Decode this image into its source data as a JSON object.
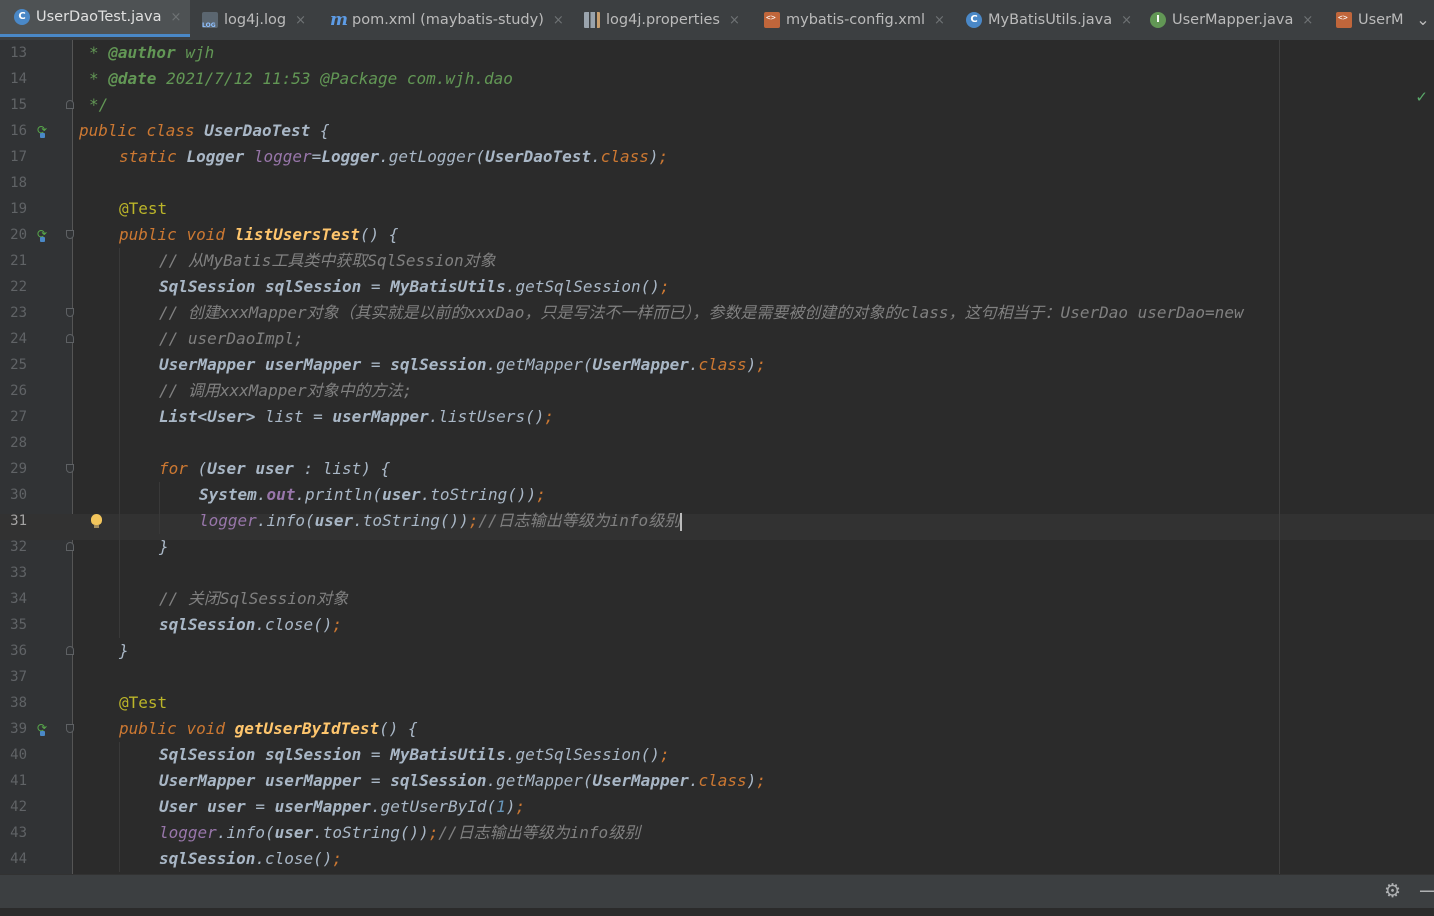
{
  "tabs": [
    {
      "label": "UserDaoTest.java",
      "icon": "java-class-icon",
      "active": true
    },
    {
      "label": "log4j.log",
      "icon": "log-file-icon"
    },
    {
      "label": "pom.xml (maybatis-study)",
      "icon": "maven-icon"
    },
    {
      "label": "log4j.properties",
      "icon": "properties-file-icon"
    },
    {
      "label": "mybatis-config.xml",
      "icon": "xml-file-icon"
    },
    {
      "label": "MyBatisUtils.java",
      "icon": "java-class-icon"
    },
    {
      "label": "UserMapper.java",
      "icon": "java-interface-icon"
    },
    {
      "label": "UserM",
      "icon": "xml-file-icon"
    }
  ],
  "tab_close_glyph": "×",
  "editor": {
    "current_line": "31",
    "line_numbers": [
      "13",
      "14",
      "15",
      "16",
      "17",
      "18",
      "19",
      "20",
      "21",
      "22",
      "23",
      "24",
      "25",
      "26",
      "27",
      "28",
      "29",
      "30",
      "31",
      "32",
      "33",
      "34",
      "35",
      "36",
      "37",
      "38",
      "39",
      "40",
      "41",
      "42",
      "43",
      "44"
    ],
    "code": {
      "l13_tag": "@author",
      "l13_text": " wjh",
      "l14_tag": "@date",
      "l14_text": " 2021/7/12 11:53 @Package com.wjh.dao",
      "l15_text": "*/",
      "l16_kw1": "public",
      "l16_kw2": "class",
      "l16_name": "UserDaoTest",
      "l16_brace": " {",
      "l17_kw": "static",
      "l17_type": "Logger",
      "l17_field": "logger",
      "l17_eq": "=",
      "l17_cls": "Logger",
      "l17_m": "getLogger",
      "l17_arg": "UserDaoTest",
      "l17_class": "class",
      "l19_ann": "@Test",
      "l20_kw1": "public",
      "l20_kw2": "void",
      "l20_name": "listUsersTest",
      "l21_cm": "// 从MyBatis工具类中获取SqlSession对象",
      "l22_type": "SqlSession",
      "l22_var": "sqlSession",
      "l22_cls": "MyBatisUtils",
      "l22_m": "getSqlSession",
      "l23_cm": "// 创建xxxMapper对象（其实就是以前的xxxDao，只是写法不一样而已），参数是需要被创建的对象的class，这句相当于：UserDao userDao=new",
      "l24_cm": "// userDaoImpl;",
      "l25_type": "UserMapper",
      "l25_var": "userMapper",
      "l25_obj": "sqlSession",
      "l25_m": "getMapper",
      "l25_arg": "UserMapper",
      "l25_class": "class",
      "l26_cm": "// 调用xxxMapper对象中的方法;",
      "l27_type": "List<User>",
      "l27_var": "list",
      "l27_obj": "userMapper",
      "l27_m": "listUsers",
      "l29_kw": "for",
      "l29_type": "User",
      "l29_var": "user",
      "l29_list": "list",
      "l30_cls": "System",
      "l30_field": "out",
      "l30_m": "println",
      "l30_obj": "user",
      "l30_m2": "toString",
      "l31_field": "logger",
      "l31_m": "info",
      "l31_obj": "user",
      "l31_m2": "toString",
      "l31_cm": "//日志输出等级为info级别",
      "l34_cm": "// 关闭SqlSession对象",
      "l35_obj": "sqlSession",
      "l35_m": "close",
      "l38_ann": "@Test",
      "l39_kw1": "public",
      "l39_kw2": "void",
      "l39_name": "getUserByIdTest",
      "l40_type": "SqlSession",
      "l40_var": "sqlSession",
      "l40_cls": "MyBatisUtils",
      "l40_m": "getSqlSession",
      "l41_type": "UserMapper",
      "l41_var": "userMapper",
      "l41_obj": "sqlSession",
      "l41_m": "getMapper",
      "l41_arg": "UserMapper",
      "l41_class": "class",
      "l42_type": "User",
      "l42_var": "user",
      "l42_obj": "userMapper",
      "l42_m": "getUserById",
      "l42_num": "1",
      "l43_field": "logger",
      "l43_m": "info",
      "l43_obj": "user",
      "l43_m2": "toString",
      "l43_cm": "//日志输出等级为info级别",
      "l44_obj": "sqlSession",
      "l44_m": "close"
    }
  },
  "colors": {
    "background": "#2b2b2b",
    "gutter": "#313335",
    "keyword": "#cc7832",
    "comment": "#808080",
    "doc_comment": "#629755",
    "annotation": "#bbb529",
    "field": "#9876aa",
    "method": "#ffc66d",
    "number": "#6897bb",
    "text": "#a9b7c6",
    "tab_accent": "#4a88c7"
  },
  "icons": {
    "inspection": "checkmark-icon",
    "settings": "gear-icon",
    "minimize": "minimize-icon",
    "run": "run-test-icon",
    "intention": "lightbulb-icon",
    "tab_menu": "chevron-down-icon"
  },
  "glyphs": {
    "check": "✓",
    "gear": "⚙",
    "minimize": "—",
    "chevron": "⌄",
    "run": "⟳"
  }
}
